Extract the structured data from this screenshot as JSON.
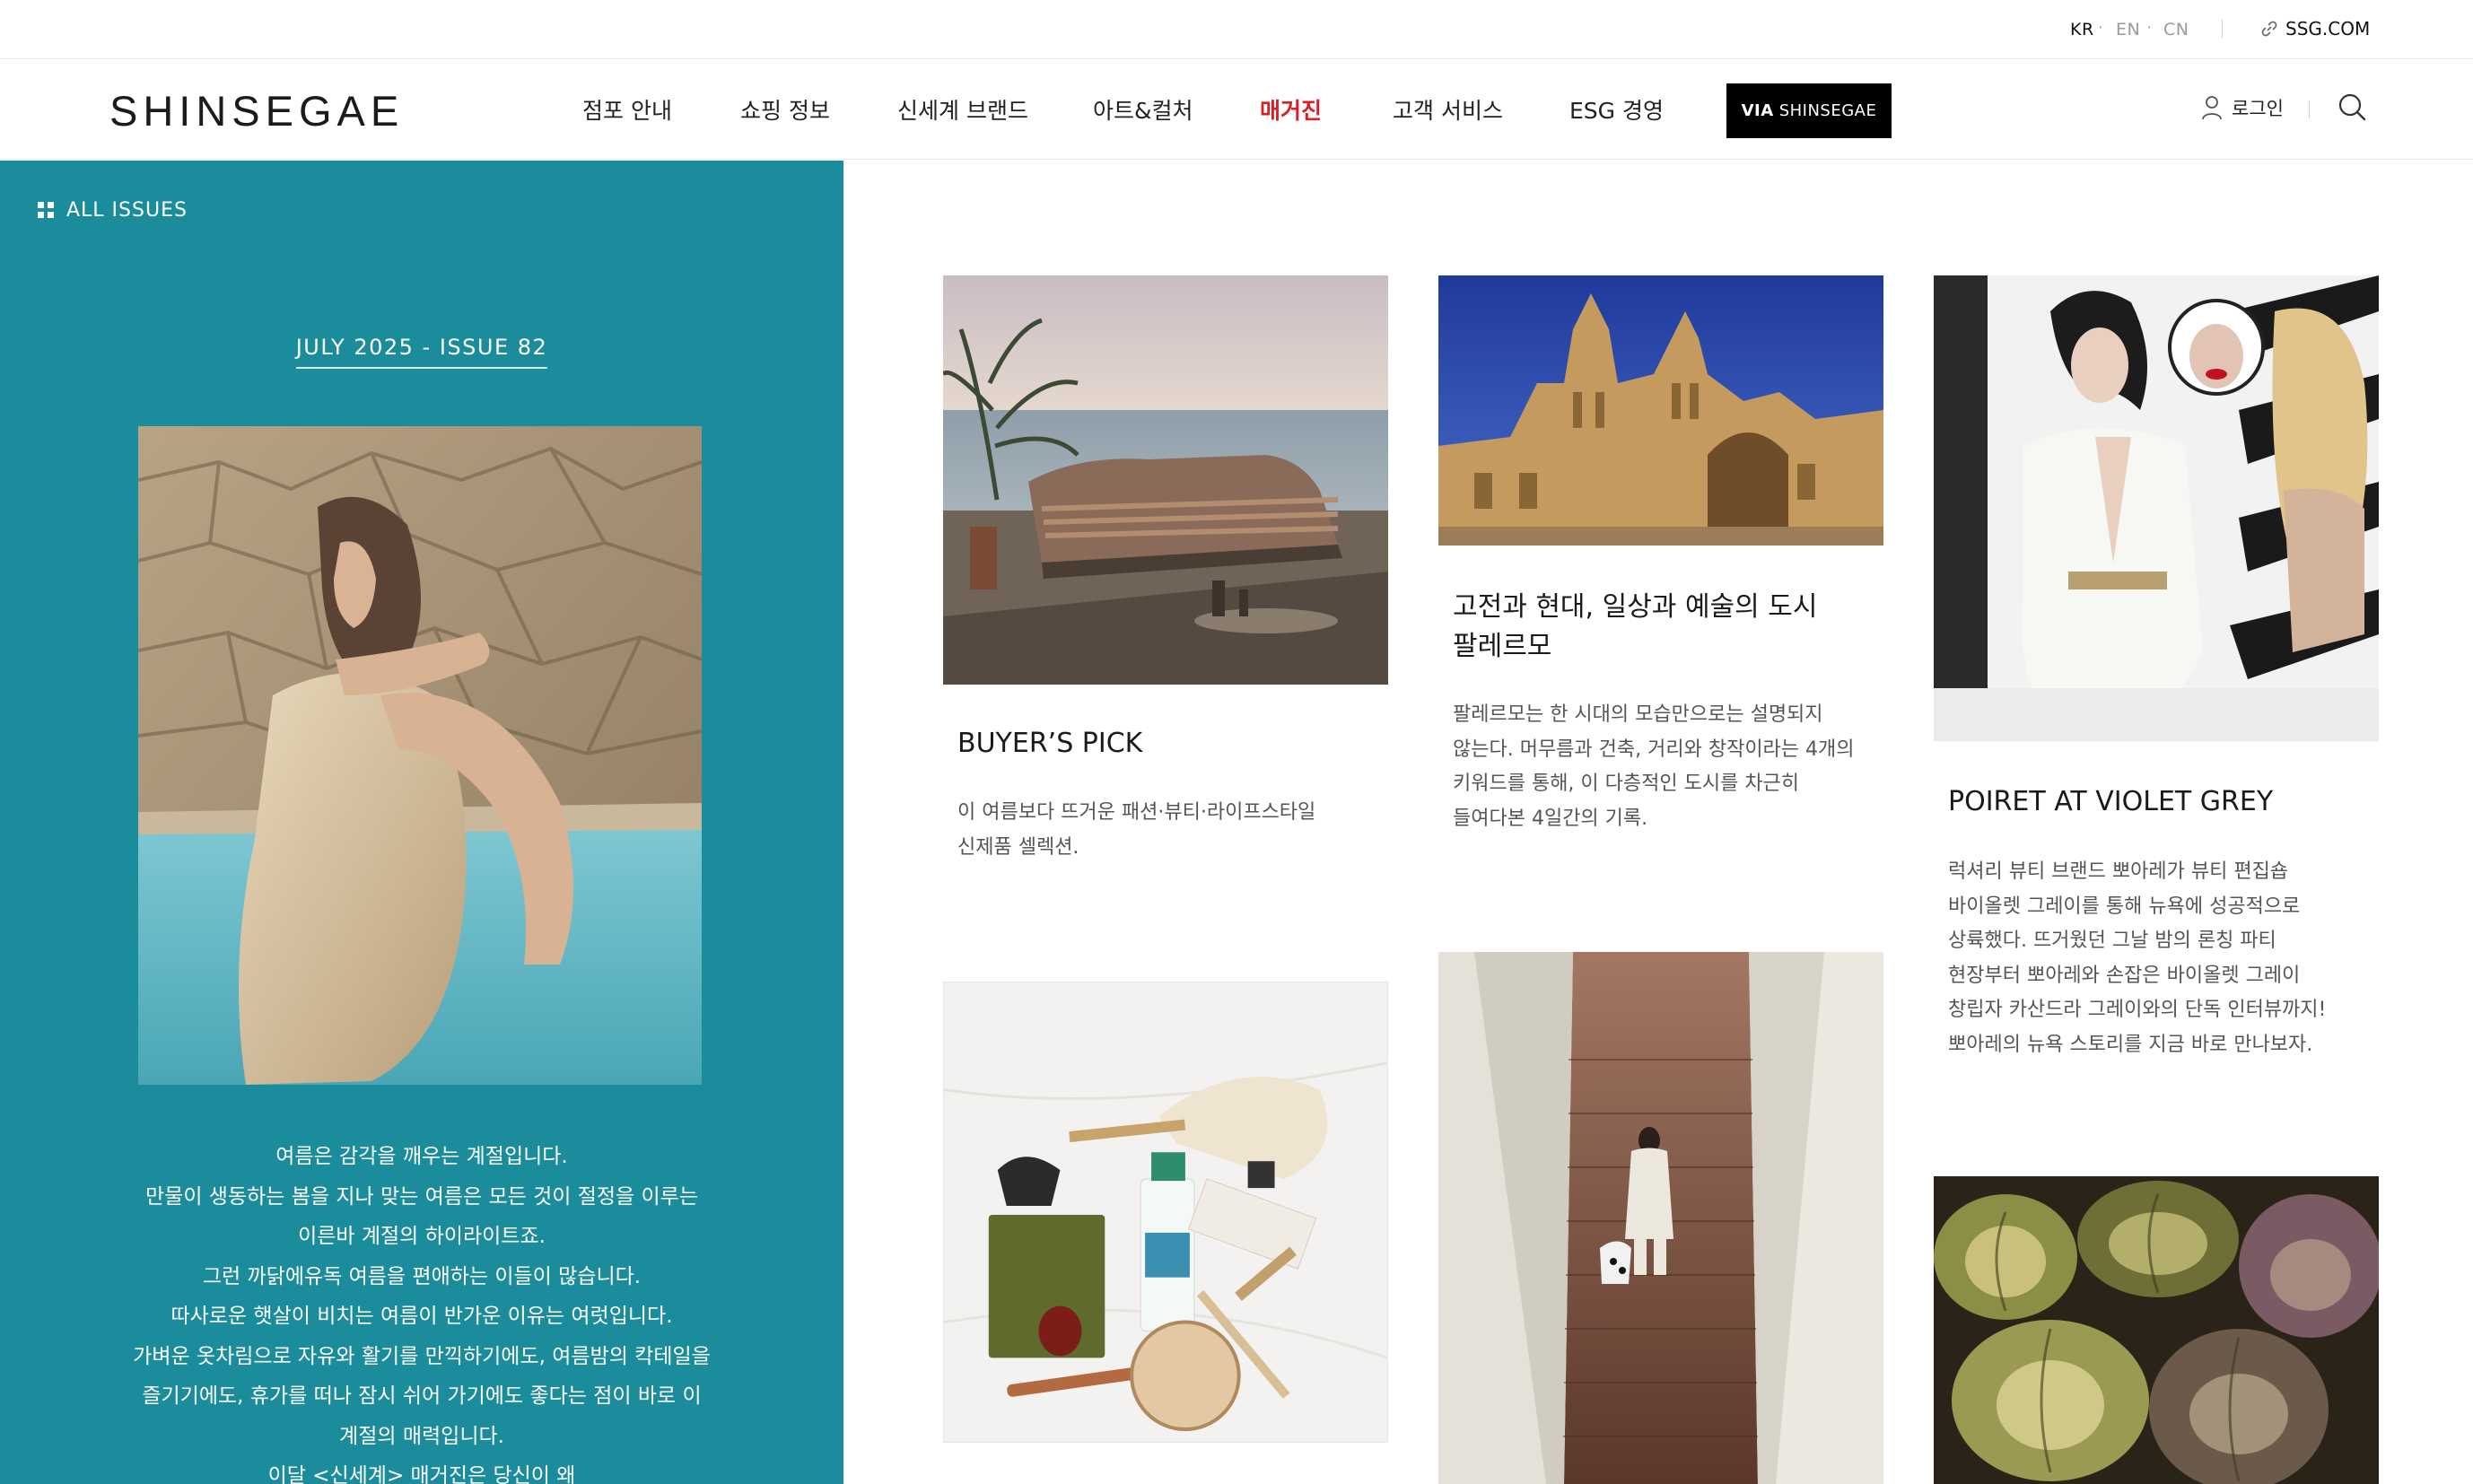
{
  "utility": {
    "languages": [
      "KR",
      "EN",
      "CN"
    ],
    "active_language": "KR",
    "ssg_link": "SSG.COM"
  },
  "header": {
    "logo": "SHINSEGAE",
    "nav": [
      "점포 안내",
      "쇼핑 정보",
      "신세계 브랜드",
      "아트&컬처",
      "매거진",
      "고객 서비스",
      "ESG 경영"
    ],
    "active_nav": "매거진",
    "via_button": {
      "bold": "VIA",
      "text": "SHINSEGAE"
    },
    "login": "로그인",
    "icons": {
      "login": "user-icon",
      "search": "search-icon",
      "ssg": "link-icon"
    }
  },
  "issue_panel": {
    "all_issues": "ALL ISSUES",
    "issue_label": "JULY 2025 - ISSUE 82",
    "background_color": "#1b8c9b",
    "intro_lines": [
      "여름은 감각을 깨우는 계절입니다.",
      "만물이 생동하는 봄을 지나 맞는 여름은 모든 것이 절정을 이루는",
      "이른바 계절의 하이라이트죠.",
      "그런 까닭에유독 여름을 편애하는 이들이 많습니다.",
      "따사로운 햇살이 비치는 여름이 반가운 이유는 여럿입니다.",
      "가벼운 옷차림으로 자유와 활기를 만끽하기에도, 여름밤의 칵테일을",
      "즐기기에도, 휴가를 떠나 잠시 쉬어 가기에도 좋다는 점이 바로 이",
      "계절의 매력입니다.",
      "이달 <신세계> 매거진은 당신이 왜"
    ]
  },
  "articles": [
    {
      "title": "BUYER’S PICK",
      "description": [
        "이 여름보다 뜨거운 패션·뷰티·라이프스타일",
        "신제품 셀렉션."
      ]
    },
    {
      "title": [
        "고전과 현대, 일상과 예술의 도시",
        "팔레르모"
      ],
      "description": [
        "팔레르모는 한 시대의 모습만으로는 설명되지",
        "않는다. 머무름과 건축, 거리와 창작이라는 4개의",
        "키워드를 통해, 이 다층적인 도시를 차근히",
        "들여다본 4일간의 기록."
      ]
    },
    {
      "title": "POIRET AT VIOLET GREY",
      "description": [
        "럭셔리 뷰티 브랜드 뽀아레가 뷰티 편집숍",
        "바이올렛 그레이를 통해 뉴욕에 성공적으로",
        "상륙했다. 뜨거웠던 그날 밤의 론칭 파티",
        "현장부터 뽀아레와 손잡은 바이올렛 그레이",
        "창립자 카산드라 그레이와의 단독 인터뷰까지!",
        "뽀아레의 뉴욕 스토리를 지금 바로 만나보자."
      ]
    }
  ]
}
